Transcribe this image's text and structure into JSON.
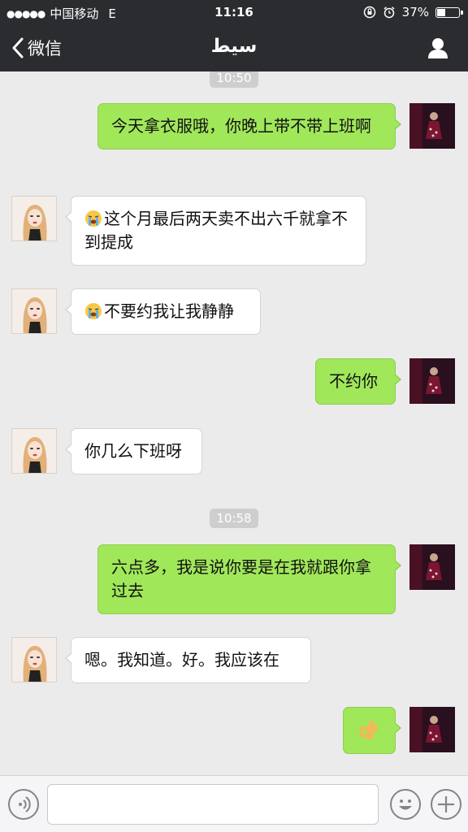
{
  "status": {
    "signal_dots": "●●●●●",
    "carrier": "中国移动",
    "network": "E",
    "time": "11:16",
    "battery": "37%",
    "battery_level": 0.37
  },
  "nav": {
    "back_label": "微信",
    "title": "سيط"
  },
  "timestamps": [
    "10:50",
    "10:58"
  ],
  "messages": [
    {
      "from": "me",
      "text": "今天拿衣服哦，你晚上带不带上班啊"
    },
    {
      "from": "other",
      "emoji": "crying-face",
      "text": "这个月最后两天卖不出六千就拿不到提成"
    },
    {
      "from": "other",
      "emoji": "crying-face",
      "text": "不要约我让我静静"
    },
    {
      "from": "me",
      "text": "不约你"
    },
    {
      "from": "other",
      "text": "你几么下班呀"
    },
    {
      "from": "me",
      "text": "六点多，我是说你要是在我就跟你拿过去"
    },
    {
      "from": "other",
      "text": "嗯。我知道。好。我应该在"
    },
    {
      "from": "me",
      "emoji": "ok-hand",
      "text": ""
    }
  ],
  "input": {
    "value": "",
    "placeholder": ""
  },
  "icons": {
    "voice": "voice-icon",
    "emoji": "emoji-icon",
    "plus": "plus-icon"
  },
  "colors": {
    "header_bg": "#2b2c30",
    "chat_bg": "#ebebeb",
    "my_bubble": "#a0e75a",
    "other_bubble": "#ffffff"
  }
}
